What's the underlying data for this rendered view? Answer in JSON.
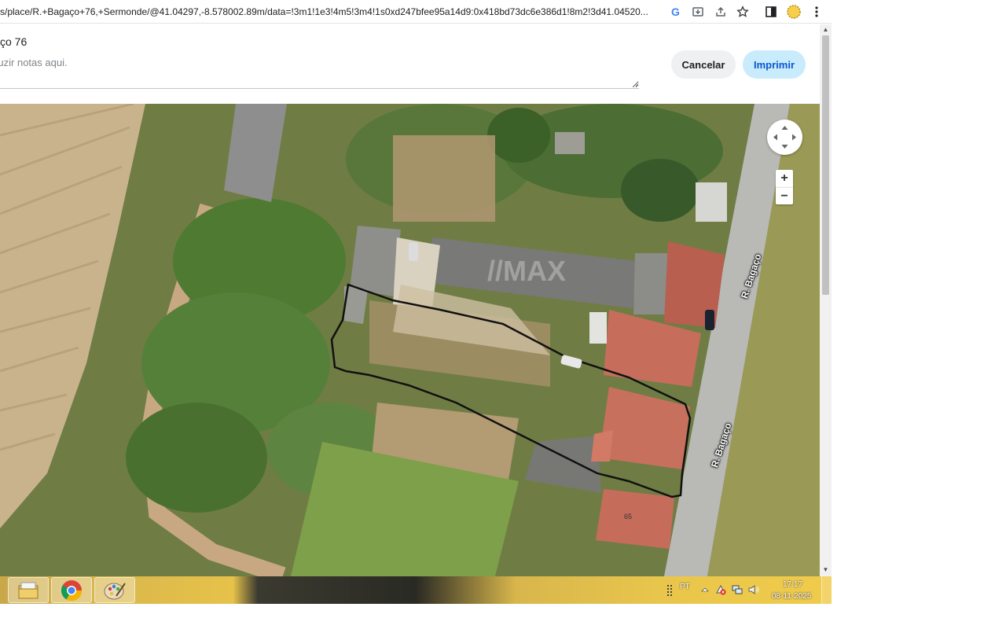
{
  "browser": {
    "url": "s/place/R.+Bagaço+76,+Sermonde/@41.04297,-8.578002.89m/data=!3m1!1e3!4m5!3m4!1s0xd247bfee95a14d9:0x418bd73dc6e386d1!8m2!3d41.04520...",
    "icons": [
      "google-lens-icon",
      "install-icon",
      "share-icon",
      "star-icon",
      "side-panel-icon",
      "profile-icon",
      "menu-icon"
    ]
  },
  "print": {
    "title": "ço 76",
    "notes_placeholder": "troduzir notas aqui.",
    "cancel_label": "Cancelar",
    "print_label": "Imprimir"
  },
  "map": {
    "mode": "satellite",
    "streets": [
      "R. Bagaço",
      "R. Bagaço"
    ],
    "house_number": "65",
    "zoom_in": "+",
    "zoom_out": "−"
  },
  "taskbar": {
    "apps": [
      "file-explorer-icon",
      "chrome-icon",
      "paint-icon"
    ],
    "language": "PT",
    "time": "17:17",
    "date": "08-11-2025"
  },
  "colors": {
    "print_button": "#c8ecfb",
    "print_text": "#0b57d0",
    "cancel_button": "#eef0f2",
    "parcel_outline": "#111111"
  }
}
